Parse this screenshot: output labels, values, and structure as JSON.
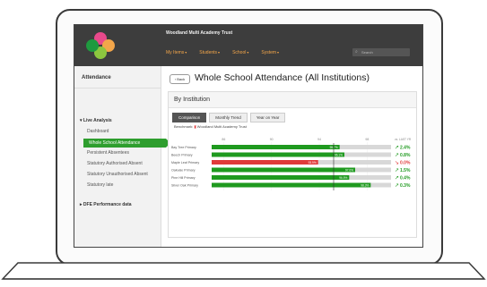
{
  "app": {
    "trust_name": "Woodland Multi Academy Trust",
    "nav": [
      "My Items",
      "Students",
      "School",
      "System"
    ],
    "search_placeholder": "Search"
  },
  "sidebar": {
    "title": "Attendance",
    "groups": [
      {
        "label": "Live Analysis",
        "expanded": true
      },
      {
        "label": "DFE Performance data",
        "expanded": false
      }
    ],
    "items": [
      "Dashboard",
      "Whole School Attendance",
      "Persistent Absentees",
      "Statutory Authorised Absent",
      "Statutory Unauthorised Absent",
      "Statutory late"
    ],
    "active_index": 1
  },
  "main": {
    "back_label": "Back",
    "title": "Whole School Attendance (All Institutions)",
    "panel_title": "By Institution",
    "tabs": [
      "Comparison",
      "Monthly Trend",
      "Year on Year"
    ],
    "active_tab": 0,
    "benchmark_label": "Benchmark:",
    "benchmark_value": "Woodland Multi Academy Trust"
  },
  "chart_data": {
    "type": "bar",
    "orientation": "horizontal",
    "categories": [
      "Bay Tree Primary",
      "Beech Primary",
      "Maple Leaf Primary",
      "Oakvale Primary",
      "Pine Hill Primary",
      "Silver Oak Primary"
    ],
    "values": [
      95.7,
      96.1,
      93.9,
      97.0,
      96.5,
      98.3
    ],
    "value_labels": [
      "95.7%",
      "96.1%",
      "93.9%",
      "97.0%",
      "96.5%",
      "98.3%"
    ],
    "benchmark": 95.2,
    "xlim": [
      85,
      100
    ],
    "x_ticks": [
      86,
      90,
      94,
      98
    ],
    "change_header": "vs. LAST YR",
    "changes": [
      "2.4%",
      "0.8%",
      "0.0%",
      "1.5%",
      "0.4%",
      "0.3%"
    ],
    "change_direction": [
      "up",
      "up",
      "down",
      "up",
      "up",
      "up"
    ],
    "colors": {
      "above": "#1f9a1f",
      "below": "#e03a3a",
      "track": "#d8d8d8",
      "up": "#1f9a1f",
      "down": "#e03a3a"
    }
  }
}
